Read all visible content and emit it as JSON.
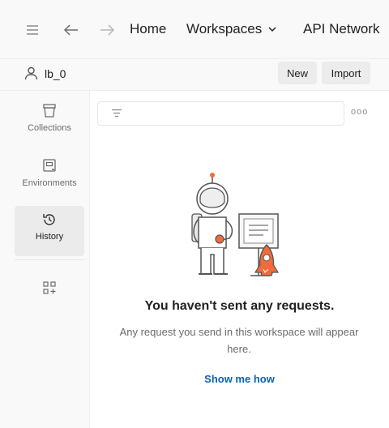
{
  "topbar": {
    "nav": {
      "home": "Home",
      "workspaces": "Workspaces",
      "api_network": "API Network"
    }
  },
  "workspace": {
    "name": "lb_0",
    "new_label": "New",
    "import_label": "Import"
  },
  "sidebar": {
    "items": [
      {
        "label": "Collections",
        "icon": "collections-icon"
      },
      {
        "label": "Environments",
        "icon": "environments-icon"
      },
      {
        "label": "History",
        "icon": "history-icon",
        "active": true
      },
      {
        "label": "",
        "icon": "add-apps-icon"
      }
    ]
  },
  "main": {
    "filter_placeholder": "",
    "empty_title": "You haven't sent any requests.",
    "empty_desc": "Any request you send in this workspace will appear here.",
    "link_label": "Show me how"
  },
  "colors": {
    "accent_link": "#0b62b5",
    "rocket": "#f26b3a"
  }
}
